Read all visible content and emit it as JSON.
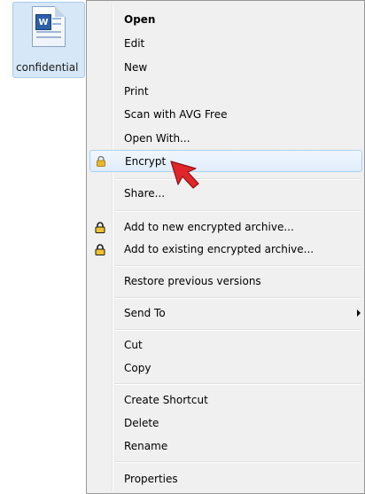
{
  "file": {
    "name": "confidential",
    "type_badge": "W"
  },
  "menu": {
    "items": [
      {
        "label": "Open",
        "bold": true
      },
      {
        "label": "Edit"
      },
      {
        "label": "New"
      },
      {
        "label": "Print"
      },
      {
        "label": "Scan with AVG Free"
      },
      {
        "label": "Open With..."
      },
      {
        "label": "Encrypt",
        "icon": "lock-icon",
        "highlighted": true
      },
      {
        "label": "Share..."
      },
      {
        "label": "Add to new encrypted archive...",
        "icon": "padlock-icon"
      },
      {
        "label": "Add to existing encrypted archive...",
        "icon": "padlock-icon"
      },
      {
        "label": "Restore previous versions"
      },
      {
        "label": "Send To",
        "has_submenu": true
      },
      {
        "label": "Cut"
      },
      {
        "label": "Copy"
      },
      {
        "label": "Create Shortcut"
      },
      {
        "label": "Delete"
      },
      {
        "label": "Rename"
      },
      {
        "label": "Properties"
      }
    ]
  },
  "colors": {
    "menu_bg": "#f0f0f0",
    "hover_border": "#a8d3f5",
    "lock_gold": "#e8b630",
    "cursor_red": "#e0262b"
  }
}
